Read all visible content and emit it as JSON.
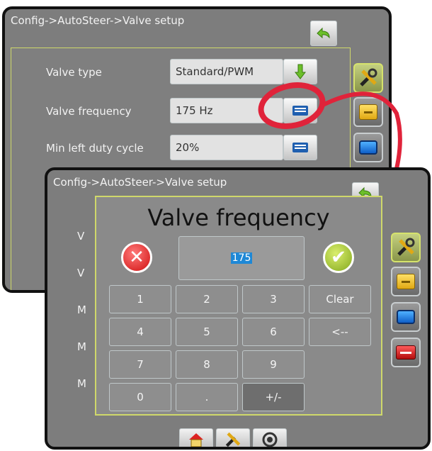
{
  "back_screen": {
    "breadcrumb": "Config->AutoSteer->Valve setup",
    "rows": [
      {
        "label": "Valve type",
        "value": "Standard/PWM"
      },
      {
        "label": "Valve frequency",
        "value": "175 Hz"
      },
      {
        "label": "Min left duty cycle",
        "value": "20%"
      }
    ]
  },
  "front_screen": {
    "breadcrumb": "Config->AutoSteer->Valve setup",
    "partial_row_labels": [
      "V",
      "V",
      "M",
      "M",
      "M"
    ]
  },
  "dialog": {
    "title": "Valve frequency",
    "value": "175",
    "keys": [
      [
        "1",
        "2",
        "3",
        "Clear"
      ],
      [
        "4",
        "5",
        "6",
        "<--"
      ],
      [
        "7",
        "8",
        "9"
      ],
      [
        "0",
        ".",
        "+/-"
      ]
    ]
  },
  "icons": {
    "back": "back-arrow-icon",
    "dropdown": "down-arrow-icon",
    "keyboard": "keyboard-icon",
    "cancel": "cancel-x-icon",
    "ok": "checkmark-icon",
    "tools": "tools-icon",
    "folder": "folder-icon",
    "display": "display-icon",
    "toolbox": "toolbox-icon",
    "home": "home-icon",
    "gps": "gps-icon"
  },
  "colors": {
    "highlight_ring": "#e0233a",
    "panel_border": "#cfd86a",
    "selected_value": "#1e88d6"
  }
}
